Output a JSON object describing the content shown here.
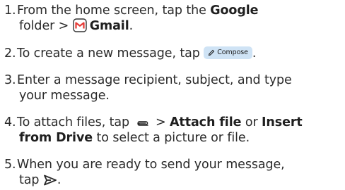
{
  "steps": [
    {
      "num": "1.",
      "line1_pre": "From the home screen, tap the ",
      "line1_bold": "Google",
      "line2_pre": "folder > ",
      "line2_bold": "Gmail",
      "line2_post": ".",
      "icon": "gmail-icon"
    },
    {
      "num": "2.",
      "pre": "To create a new message, tap ",
      "chip_icon": "pencil-icon",
      "chip_label": "Compose",
      "post": "."
    },
    {
      "num": "3.",
      "line1": "Enter a message recipient, subject, and type",
      "line2": "your message."
    },
    {
      "num": "4.",
      "line1_pre": "To attach files, tap ",
      "icon": "paperclip-icon",
      "line1_mid": " > ",
      "line1_bold1": "Attach file",
      "line1_mid2": " or ",
      "line1_bold2": "Insert",
      "line2_bold": "from Drive",
      "line2_post": " to select a picture or file."
    },
    {
      "num": "5.",
      "line1": "When you are ready to send your message,",
      "line2_pre": "tap ",
      "icon": "send-icon",
      "line2_post": "."
    }
  ],
  "colors": {
    "text": "#2a2a2a",
    "chip_bg": "#cfe3f5",
    "gmail_red": "#e53935"
  }
}
